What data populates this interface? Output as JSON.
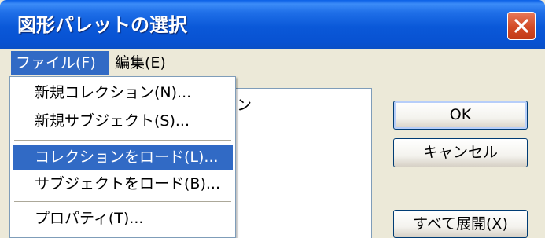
{
  "window": {
    "title": "図形パレットの選択",
    "close_icon": "close-icon"
  },
  "menubar": {
    "file": "ファイル(F)",
    "edit": "編集(E)"
  },
  "file_menu": {
    "items": [
      "新規コレクション(N)...",
      "新規サブジェクト(S)...",
      "コレクションをロード(L)...",
      "サブジェクトをロード(B)...",
      "プロパティ(T)..."
    ],
    "highlighted_index": 2
  },
  "list": {
    "partial_text": "ン"
  },
  "buttons": {
    "ok": "OK",
    "cancel": "キャンセル",
    "expand_all": "すべて展開(X)"
  },
  "colors": {
    "title_bar": "#0a58d8",
    "menu_highlight": "#316ac5",
    "dialog_bg": "#ece9d8",
    "close_button": "#d24a25"
  }
}
